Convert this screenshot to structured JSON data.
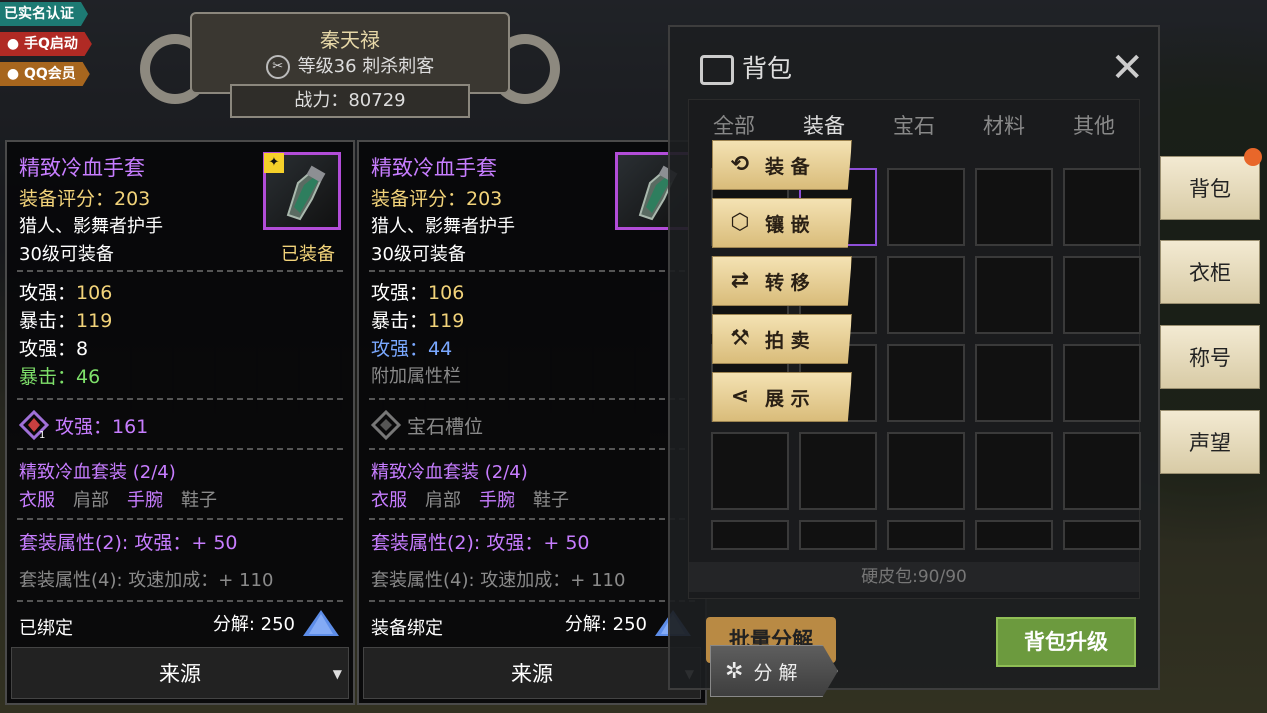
{
  "badges": {
    "realname": "已实名认证",
    "qq_launch": "手Q启动",
    "qq_member": "QQ会员"
  },
  "character": {
    "name": "秦天禄",
    "level_text": "等级36 刺杀刺客",
    "power": "战力：80729"
  },
  "tooltip_equipped": {
    "name": "精致冷血手套",
    "score": "装备评分：203",
    "classes": "猎人、影舞者护手",
    "requirement": "30级可装备",
    "equipped_label": "已装备",
    "stats": [
      {
        "label": "攻强：",
        "value": "106"
      },
      {
        "label": "暴击：",
        "value": "119"
      },
      {
        "label": "攻强：",
        "value": "8"
      },
      {
        "label": "暴击：",
        "value": "46"
      }
    ],
    "gem": "攻强：161",
    "gem_rank": "1",
    "set_title": "精致冷血套装 (2/4)",
    "set_pieces": [
      "衣服",
      "肩部",
      "手腕",
      "鞋子"
    ],
    "set_bonus_2": "套装属性(2): 攻强：+ 50",
    "set_bonus_4": "套装属性(4): 攻速加成：+ 110",
    "bind": "已绑定",
    "decompose": "分解: 250",
    "source": "来源"
  },
  "tooltip_new": {
    "name": "精致冷血手套",
    "score": "装备评分：203",
    "classes": "猎人、影舞者护手",
    "requirement": "30级可装备",
    "stats": [
      {
        "label": "攻强：",
        "value": "106"
      },
      {
        "label": "暴击：",
        "value": "119"
      },
      {
        "label": "攻强：",
        "value": "44"
      }
    ],
    "extra_slot": "附加属性栏",
    "gem_slot": "宝石槽位",
    "set_title": "精致冷血套装 (2/4)",
    "set_pieces": [
      "衣服",
      "肩部",
      "手腕",
      "鞋子"
    ],
    "set_bonus_2": "套装属性(2): 攻强：+ 50",
    "set_bonus_4": "套装属性(4): 攻速加成：+ 110",
    "bind": "装备绑定",
    "decompose": "分解: 250",
    "source": "来源"
  },
  "bag": {
    "title": "背包",
    "tabs": [
      "全部",
      "装备",
      "宝石",
      "材料",
      "其他"
    ],
    "active_tab": "装备",
    "capacity": "硬皮包:90/90",
    "bulk_decompose": "批量分解",
    "upgrade": "背包升级"
  },
  "actions": {
    "equip": "装 备",
    "inlay": "镶 嵌",
    "transfer": "转 移",
    "auction": "拍 卖",
    "show": "展 示",
    "decompose": "分 解"
  },
  "side_tabs": [
    "背包",
    "衣柜",
    "称号",
    "声望"
  ],
  "colors": {
    "epic_purple": "#c77dff",
    "gold": "#f2d37a",
    "green": "#7ee06a",
    "blue": "#7aa8ff"
  }
}
